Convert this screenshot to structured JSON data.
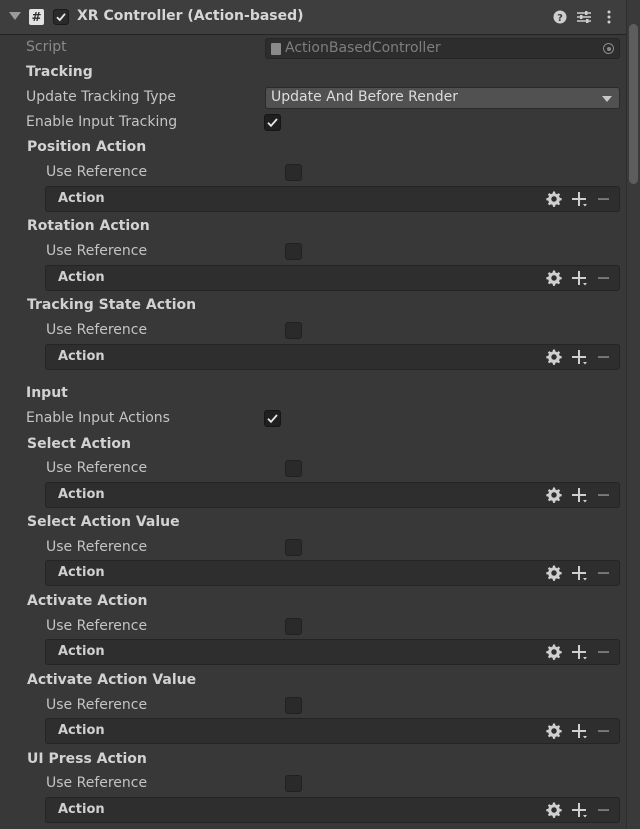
{
  "component": {
    "title": "XR Controller (Action-based)",
    "script_label": "Script",
    "script_value": "ActionBasedController"
  },
  "tracking": {
    "section": "Tracking",
    "update_type_label": "Update Tracking Type",
    "update_type_value": "Update And Before Render",
    "enable_tracking_label": "Enable Input Tracking",
    "enable_tracking_checked": true
  },
  "input": {
    "section": "Input",
    "enable_actions_label": "Enable Input Actions",
    "enable_actions_checked": true
  },
  "common": {
    "use_reference": "Use Reference",
    "action": "Action"
  },
  "actions": [
    {
      "title": "Position Action"
    },
    {
      "title": "Rotation Action"
    },
    {
      "title": "Tracking State Action"
    },
    {
      "title": "Select Action"
    },
    {
      "title": "Select Action Value"
    },
    {
      "title": "Activate Action"
    },
    {
      "title": "Activate Action Value"
    },
    {
      "title": "UI Press Action"
    }
  ],
  "icons": {
    "header": [
      "foldout-arrow-icon",
      "script-icon",
      "checkmark-icon",
      "help-icon",
      "presets-icon",
      "kebab-menu-icon"
    ],
    "action_row": [
      "gear-icon",
      "plus-icon",
      "minus-icon"
    ]
  },
  "colors": {
    "background": "#383838",
    "header": "#3e3e3e",
    "field": "#2d2d2d",
    "dropdown": "#515151",
    "text": "#c4c4c4"
  }
}
